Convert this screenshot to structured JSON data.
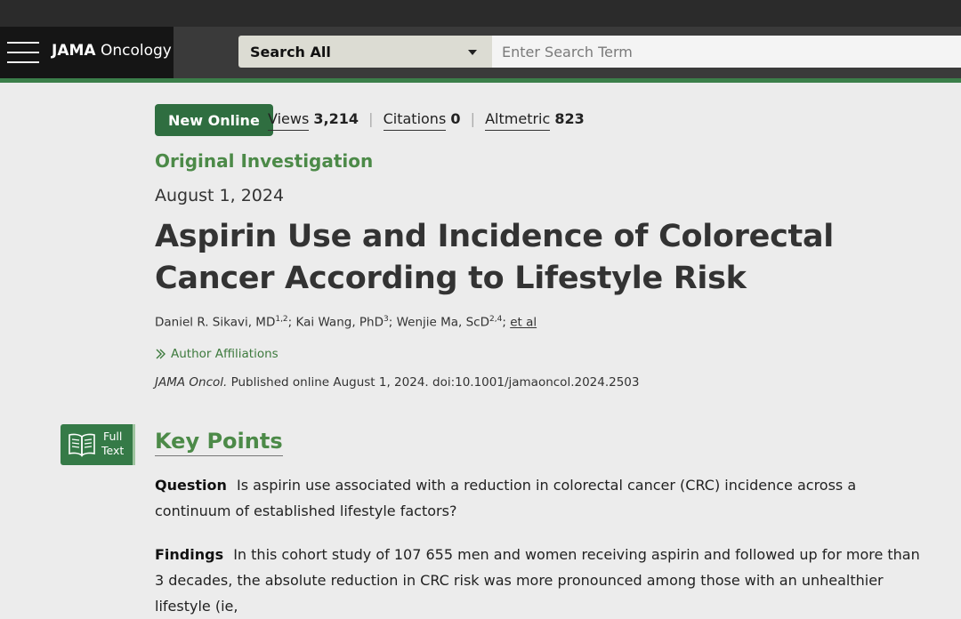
{
  "header": {
    "brand_bold": "JAMA",
    "brand_rest": "Oncology",
    "search_scope": "Search All",
    "search_placeholder": "Enter Search Term"
  },
  "meta": {
    "badge": "New Online",
    "views_label": "Views",
    "views_value": "3,214",
    "citations_label": "Citations",
    "citations_value": "0",
    "altmetric_label": "Altmetric",
    "altmetric_value": "823"
  },
  "article": {
    "type": "Original Investigation",
    "date": "August 1, 2024",
    "title": "Aspirin Use and Incidence of Colorectal Cancer According to Lifestyle Risk",
    "authors": [
      {
        "name": "Daniel R. Sikavi, MD",
        "sup": "1,2"
      },
      {
        "name": "Kai Wang, PhD",
        "sup": "3"
      },
      {
        "name": "Wenjie Ma, ScD",
        "sup": "2,4"
      }
    ],
    "et_al": "et al",
    "affiliations_label": "Author Affiliations",
    "journal_abbrev": "JAMA Oncol.",
    "citation_text": "Published online August 1, 2024. doi:10.1001/jamaoncol.2024.2503"
  },
  "fulltext_button": {
    "line1": "Full",
    "line2": "Text"
  },
  "key_points": {
    "heading": "Key Points",
    "question_label": "Question",
    "question_text": "Is aspirin use associated with a reduction in colorectal cancer (CRC) incidence across a continuum of established lifestyle factors?",
    "findings_label": "Findings",
    "findings_text": "In this cohort study of 107 655 men and women receiving aspirin and followed up for more than 3 decades, the absolute reduction in CRC risk was more pronounced among those with an unhealthier lifestyle (ie,"
  },
  "colors": {
    "accent_green": "#3b7f4a",
    "badge_green": "#2f6e40",
    "heading_green": "#4c8a48"
  }
}
